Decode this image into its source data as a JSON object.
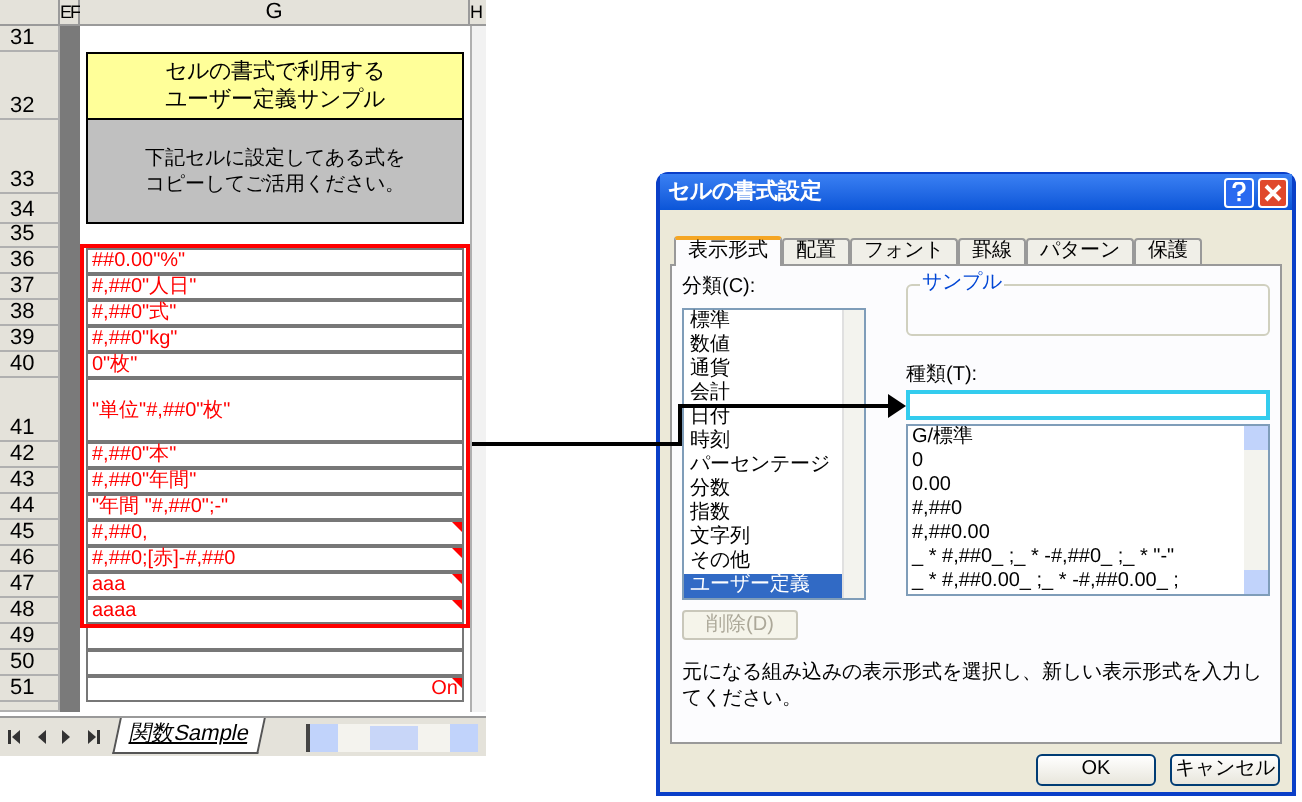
{
  "sheet": {
    "column_headers": [
      {
        "label": "EF",
        "kind": "narrow"
      },
      {
        "label": "G",
        "kind": "wide"
      },
      {
        "label": "H",
        "kind": "edge"
      }
    ],
    "rows": [
      {
        "number": "31",
        "kind": "blank"
      },
      {
        "number": "32",
        "kind": "title",
        "lines": [
          "セルの書式で利用する",
          "ユーザー定義サンプル"
        ]
      },
      {
        "number": "33",
        "kind": "note",
        "lines": [
          "下記セルに設定してある式を",
          "コピーしてご活用ください。"
        ]
      },
      {
        "number": "34",
        "kind": "merged"
      },
      {
        "number": "35",
        "kind": "spacer"
      },
      {
        "number": "36",
        "kind": "format",
        "text": "##0.00\"%\"",
        "has_comment": false
      },
      {
        "number": "37",
        "kind": "format",
        "text": "#,##0\"人日\"",
        "has_comment": false
      },
      {
        "number": "38",
        "kind": "format",
        "text": "#,##0\"式\"",
        "has_comment": false
      },
      {
        "number": "39",
        "kind": "format",
        "text": "#,##0\"kg\"",
        "has_comment": false
      },
      {
        "number": "40",
        "kind": "format",
        "text": "0\"枚\"",
        "has_comment": false
      },
      {
        "number": "41",
        "kind": "tall_format",
        "text": "\"単位\"#,##0\"枚\"",
        "has_comment": false
      },
      {
        "number": "42",
        "kind": "format",
        "text": "#,##0\"本\"",
        "has_comment": false
      },
      {
        "number": "43",
        "kind": "format",
        "text": "#,##0\"年間\"",
        "has_comment": false
      },
      {
        "number": "44",
        "kind": "format",
        "text": "\"年間 \"#,##0\";-\"",
        "has_comment": false
      },
      {
        "number": "45",
        "kind": "format",
        "text": "#,##0,",
        "has_comment": true
      },
      {
        "number": "46",
        "kind": "format",
        "text": "#,##0;[赤]-#,##0",
        "has_comment": true
      },
      {
        "number": "47",
        "kind": "format",
        "text": "aaa",
        "has_comment": true
      },
      {
        "number": "48",
        "kind": "format",
        "text": "aaaa",
        "has_comment": true
      },
      {
        "number": "49",
        "kind": "empty",
        "has_comment": false
      },
      {
        "number": "50",
        "kind": "empty",
        "has_comment": false
      },
      {
        "number": "51",
        "kind": "value",
        "text": "On",
        "has_comment": true
      },
      {
        "kind": "partial"
      }
    ],
    "sheet_tabs": [
      {
        "label": "関数Sample",
        "selected": true
      }
    ]
  },
  "dialog": {
    "title": "セルの書式設定",
    "tabs": [
      {
        "label": "表示形式",
        "selected": true
      },
      {
        "label": "配置",
        "selected": false
      },
      {
        "label": "フォント",
        "selected": false
      },
      {
        "label": "罫線",
        "selected": false
      },
      {
        "label": "パターン",
        "selected": false
      },
      {
        "label": "保護",
        "selected": false
      }
    ],
    "category_label": "分類(C):",
    "categories": [
      {
        "label": "標準",
        "selected": false
      },
      {
        "label": "数値",
        "selected": false
      },
      {
        "label": "通貨",
        "selected": false
      },
      {
        "label": "会計",
        "selected": false
      },
      {
        "label": "日付",
        "selected": false
      },
      {
        "label": "時刻",
        "selected": false
      },
      {
        "label": "パーセンテージ",
        "selected": false
      },
      {
        "label": "分数",
        "selected": false
      },
      {
        "label": "指数",
        "selected": false
      },
      {
        "label": "文字列",
        "selected": false
      },
      {
        "label": "その他",
        "selected": false
      },
      {
        "label": "ユーザー定義",
        "selected": true
      }
    ],
    "sample_label": "サンプル",
    "type_label": "種類(T):",
    "type_options": [
      "G/標準",
      "0",
      "0.00",
      "#,##0",
      "#,##0.00",
      "_ * #,##0_ ;_ * -#,##0_ ;_ * \"-\"",
      "_ * #,##0.00_ ;_ * -#,##0.00_ ;"
    ],
    "delete_button": {
      "label": "削除(D)",
      "disabled": true
    },
    "description": "元になる組み込みの表示形式を選択し、新しい表示形式を入力してください。",
    "buttons": [
      "OK",
      "キャンセル"
    ]
  }
}
